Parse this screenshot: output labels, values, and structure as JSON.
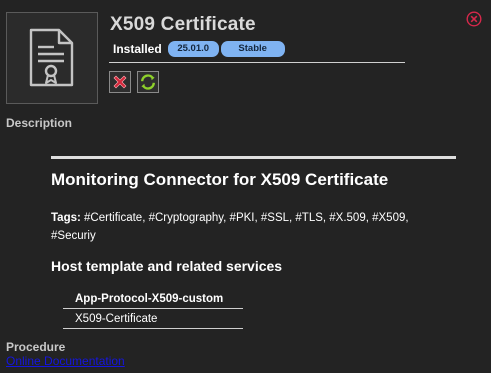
{
  "header": {
    "title": "X509 Certificate",
    "status_label": "Installed",
    "version_badge": "25.01.0",
    "stability_badge": "Stable"
  },
  "sections": {
    "description_label": "Description",
    "procedure_label": "Procedure",
    "procedure_link": "Online Documentation"
  },
  "content": {
    "title": "Monitoring Connector for X509 Certificate",
    "tags_label": "Tags:",
    "tags_text": "#Certificate, #Cryptography, #PKI, #SSL, #TLS, #X.509, #X509, #Securiy",
    "host_template_title": "Host template and related services",
    "host_template": "App-Protocol-X509-custom",
    "services": [
      "X509-Certificate"
    ]
  },
  "colors": {
    "background": "#232323",
    "badge": "#7fb3f2",
    "close": "#d6284b",
    "remove": "#d3283b",
    "update": "#8ed12b",
    "link": "#1515e0"
  },
  "icons": {
    "thumbnail": "certificate-document-icon",
    "close": "close-circle-icon",
    "remove": "remove-icon",
    "update": "update-icon"
  }
}
